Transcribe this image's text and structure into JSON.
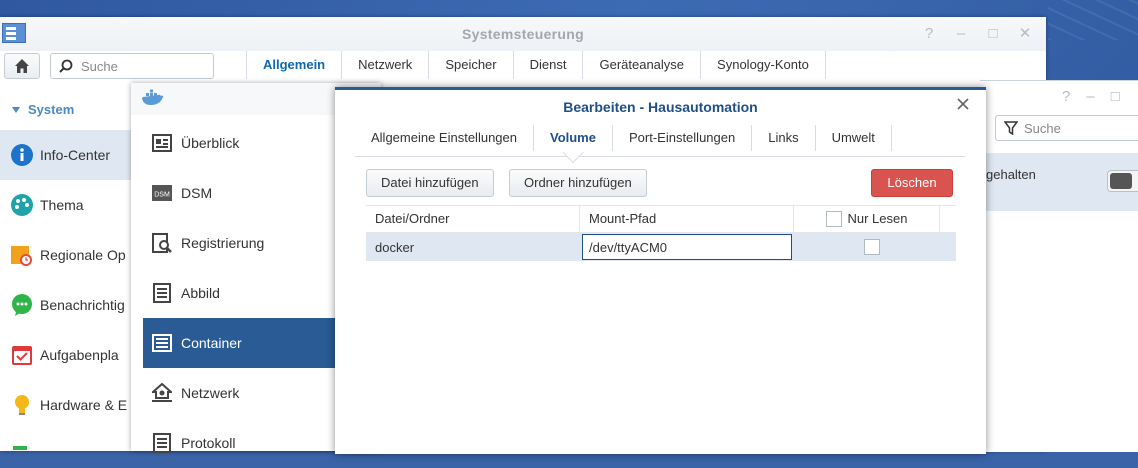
{
  "system_window": {
    "title": "Systemsteuerung",
    "window_controls": [
      "?",
      "–",
      "□",
      "✕"
    ],
    "search_placeholder": "Suche",
    "tabs": [
      {
        "label": "Allgemein",
        "active": true
      },
      {
        "label": "Netzwerk",
        "active": false
      },
      {
        "label": "Speicher",
        "active": false
      },
      {
        "label": "Dienst",
        "active": false
      },
      {
        "label": "Geräteanalyse",
        "active": false
      },
      {
        "label": "Synology-Konto",
        "active": false
      }
    ],
    "section": "System",
    "sidebar": [
      {
        "label": "Info-Center",
        "icon": "info-icon",
        "active": true
      },
      {
        "label": "Thema",
        "icon": "palette-icon",
        "active": false
      },
      {
        "label": "Regionale Op",
        "icon": "region-clock-icon",
        "active": false
      },
      {
        "label": "Benachrichtig",
        "icon": "chat-icon",
        "active": false
      },
      {
        "label": "Aufgabenpla",
        "icon": "calendar-icon",
        "active": false
      },
      {
        "label": "Hardware & E",
        "icon": "bulb-icon",
        "active": false
      }
    ]
  },
  "docker_window": {
    "nav": [
      {
        "label": "Überblick",
        "icon": "overview-icon",
        "active": false
      },
      {
        "label": "DSM",
        "icon": "dsm-icon",
        "active": false
      },
      {
        "label": "Registrierung",
        "icon": "registry-icon",
        "active": false
      },
      {
        "label": "Abbild",
        "icon": "image-icon",
        "active": false
      },
      {
        "label": "Container",
        "icon": "container-icon",
        "active": true
      },
      {
        "label": "Netzwerk",
        "icon": "network-icon",
        "active": false
      },
      {
        "label": "Protokoll",
        "icon": "log-icon",
        "active": false
      }
    ]
  },
  "background_window": {
    "search_placeholder": "Suche",
    "row_text": "gehalten"
  },
  "dialog": {
    "title": "Bearbeiten - Hausautomation",
    "tabs": [
      {
        "label": "Allgemeine Einstellungen",
        "active": false
      },
      {
        "label": "Volume",
        "active": true
      },
      {
        "label": "Port-Einstellungen",
        "active": false
      },
      {
        "label": "Links",
        "active": false
      },
      {
        "label": "Umwelt",
        "active": false
      }
    ],
    "buttons": {
      "add_file": "Datei hinzufügen",
      "add_folder": "Ordner hinzufügen",
      "delete": "Löschen"
    },
    "table": {
      "columns": [
        "Datei/Ordner",
        "Mount-Pfad",
        "Nur Lesen"
      ],
      "rows": [
        {
          "file": "docker",
          "mount_path": "/dev/ttyACM0",
          "read_only": false
        }
      ]
    }
  },
  "colors": {
    "accent": "#2a5b95",
    "title_blue": "#1e4f8a",
    "danger": "#d9534f",
    "selection": "#dfe8f2"
  }
}
